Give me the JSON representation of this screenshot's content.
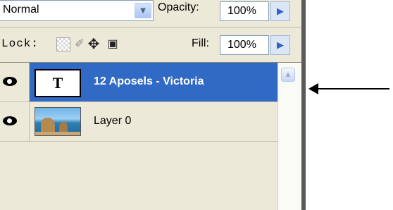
{
  "toolbar": {
    "blend_mode": "Normal",
    "opacity_label": "Opacity:",
    "opacity_value": "100%",
    "lock_label": "Lock:",
    "fill_label": "Fill:",
    "fill_value": "100%"
  },
  "icons": {
    "dropdown": "chevron-down-icon",
    "stepper": "triangle-right-icon",
    "lock_transparent": "checkerboard-icon",
    "lock_image": "brush-icon",
    "lock_position": "move-icon",
    "lock_all": "padlock-icon",
    "visibility": "eye-icon",
    "scroll_up": "scroll-up-arrow-icon"
  },
  "layers": [
    {
      "name": "12 Aposels - Victoria",
      "thumbnail_glyph": "T",
      "selected": true
    },
    {
      "name": "Layer 0",
      "selected": false
    }
  ],
  "colors": {
    "selection": "#316ac5",
    "panel": "#ece9d8",
    "annotation_arrow": "#000000"
  }
}
